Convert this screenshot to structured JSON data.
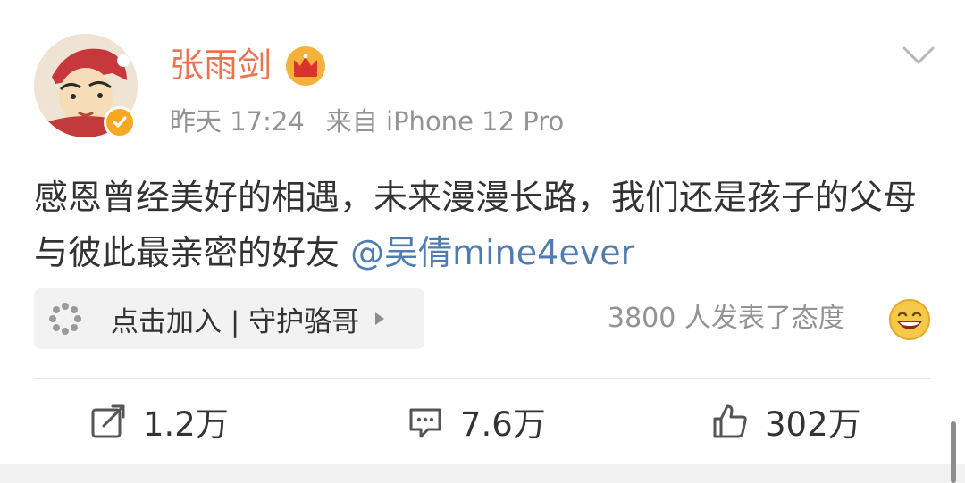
{
  "post": {
    "author": {
      "name": "张雨剑",
      "crown_icon": "crown-icon",
      "verified_icon": "verified-badge-icon"
    },
    "meta": {
      "time": "昨天 17:24",
      "source": "来自 iPhone 12 Pro"
    },
    "content": {
      "text": "感恩曾经美好的相遇，未来漫漫长路，我们还是孩子的父母与彼此最亲密的好友",
      "mention": "@吴倩mine4ever"
    },
    "super_topic": {
      "label": "点击加入 | 守护骆哥",
      "icon": "super-topic-icon"
    },
    "attitude_summary": {
      "text": "3800 人发表了态度",
      "icon": "laughing-emoji-icon"
    },
    "actions": {
      "repost_count": "1.2万",
      "comment_count": "7.6万",
      "like_count": "302万"
    }
  },
  "colors": {
    "name": "#eb7350",
    "mention": "#507daf",
    "meta": "#939393",
    "text": "#333333",
    "verified": "#f7a823"
  }
}
